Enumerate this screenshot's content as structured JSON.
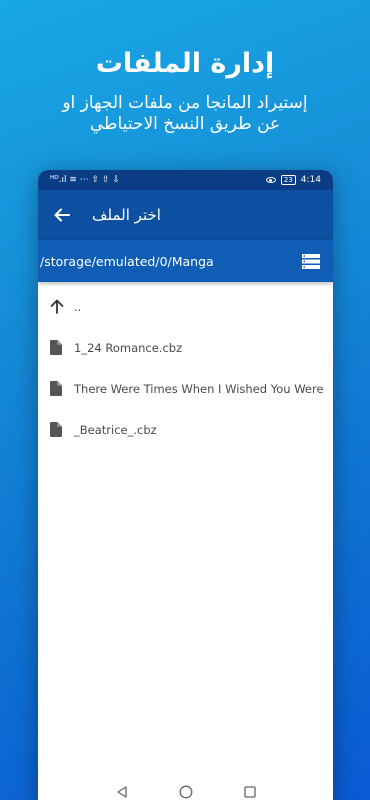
{
  "promo": {
    "title": "إدارة الملفات",
    "subtitle_line1": "إستيراد المانجا من ملفات الجهاز او",
    "subtitle_line2": "عن طريق النسخ الاحتياطي"
  },
  "status_bar": {
    "left_glyphs": "ᴴᴰ.ıl ≋ ⋯ ⇧ ⇧ ⇩",
    "battery": "23",
    "time": "4:14"
  },
  "app_bar": {
    "title": "اختر الملف"
  },
  "path_bar": {
    "path": "/storage/emulated/0/Manga"
  },
  "files": [
    {
      "name": "..",
      "type": "parent"
    },
    {
      "name": "1_24 Romance.cbz",
      "type": "file"
    },
    {
      "name": "There Were Times When I Wished You Were",
      "type": "file"
    },
    {
      "name": "_Beatrice_.cbz",
      "type": "file"
    }
  ],
  "colors": {
    "status_bar": "#0b3d86",
    "app_bar": "#0d4fa0",
    "path_bar": "#0f5db4",
    "background_top": "#18a8e6",
    "background_bottom": "#0a5ad4"
  }
}
